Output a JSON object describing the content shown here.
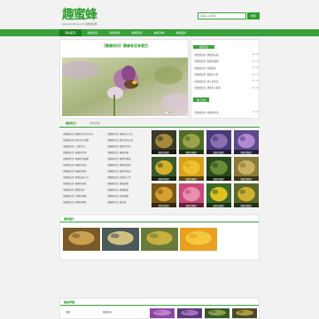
{
  "site": {
    "logo": "趣蜜蜂",
    "tagline": "www.qumifeng.com 蜜蜂知识网"
  },
  "search": {
    "placeholder": "请输入关键词",
    "button": "搜索"
  },
  "nav": [
    "网站首页",
    "蜜蜂知识",
    "蜜蜂养殖",
    "蜂蜜知识",
    "蜂蜜功效",
    "蜂蜜图片"
  ],
  "featured": {
    "title": "【蜜蜂知识】蜜蜂有没有尾巴"
  },
  "side": {
    "pill": "蜜蜂知识",
    "list1": [
      {
        "text": "【蜜蜂知识】蜂蜜的功效",
        "date": "08-20"
      },
      {
        "text": "【蜜蜂知识】蜜蜂的品种",
        "date": "08-20"
      },
      {
        "text": "【蜜蜂知识】养蜂技术",
        "date": "08-20"
      },
      {
        "text": "【蜜蜂知识】蜜蜂怎么养",
        "date": "08-20"
      },
      {
        "text": "【蜜蜂知识】蜂王的寿命",
        "date": "08-20"
      },
      {
        "text": "【蜜蜂知识】蜂蜜怎么保存",
        "date": "08-20"
      }
    ],
    "bar": "热门文章",
    "list2": [
      {
        "text": "【蜜蜂知识】蜂蜜的吃法",
        "date": "08-20"
      }
    ]
  },
  "tabs": {
    "active": "蜜蜂知识",
    "other": "蜜蜂养殖"
  },
  "articles": {
    "col1": [
      "【蜜蜂知识】蜜蜂的寿命有多长",
      "【蜜蜂知识】蜂王的产卵量",
      "【蜜蜂知识】工蜂的分工",
      "【蜜蜂知识】雄蜂的作用",
      "【蜜蜂知识】蜜蜂如何酿蜜",
      "【蜜蜂知识】蜜蜂的天敌",
      "【蜜蜂知识】蜂巢的结构",
      "【蜜蜂知识】蜜蜂会蜇人吗",
      "【蜜蜂知识】蜜蜂的视觉",
      "【蜜蜂知识】蜜蜂分蜂",
      "【蜜蜂知识】中蜂和意蜂",
      "【蜜蜂知识】蜂蜜的种类"
    ],
    "col2": [
      "【蜜蜂知识】蜜蜂怎么过冬",
      "【蜜蜂知识】蜂王浆的功效",
      "【蜜蜂知识】蜂胶的作用",
      "【蜜蜂知识】蜜蜂采蜜",
      "【蜜蜂知识】蜜蜂的舞蹈",
      "【蜜蜂知识】蜜蜂的身体",
      "【蜜蜂知识】蜂群的组成",
      "【蜜蜂知识】养蜂的工具",
      "【蜜蜂知识】蜜源植物",
      "【蜜蜂知识】蜂蜜结晶",
      "【蜜蜂知识】真假蜂蜜",
      "【蜜蜂知识】蜂花粉"
    ]
  },
  "grid": [
    {
      "caption": "蜜蜂采蜜图片",
      "color1": "#3b3a28",
      "color2": "#a58a3a"
    },
    {
      "caption": "蜜蜂采蜜图片",
      "color1": "#4f6b2a",
      "color2": "#9aa24a"
    },
    {
      "caption": "蜜蜂采蜜图片",
      "color1": "#4a3a7a",
      "color2": "#8a6fb0"
    },
    {
      "caption": "蜜蜂采蜜图片",
      "color1": "#5a4a8a",
      "color2": "#b08ad0"
    },
    {
      "caption": "蜜蜂采蜜图片",
      "color1": "#3a5a2a",
      "color2": "#d6b02a"
    },
    {
      "caption": "蜜蜂采蜜图片",
      "color1": "#d6a01a",
      "color2": "#f0c030"
    },
    {
      "caption": "蜜蜂采蜜图片",
      "color1": "#2a4a1a",
      "color2": "#6a8a3a"
    },
    {
      "caption": "蜜蜂采蜜图片",
      "color1": "#8a7a3a",
      "color2": "#c8b060"
    },
    {
      "caption": "蜜蜂采蜜图片",
      "color1": "#7a5a1a",
      "color2": "#d8a030"
    },
    {
      "caption": "蜜蜂采蜜图片",
      "color1": "#c84a7a",
      "color2": "#e890b0"
    },
    {
      "caption": "蜜蜂采蜜图片",
      "color1": "#3a6a2a",
      "color2": "#e0c020"
    },
    {
      "caption": "蜜蜂采蜜图片",
      "color1": "#5a6a2a",
      "color2": "#d0b030"
    }
  ],
  "sec2": {
    "title": "蜜蜂图片",
    "imgs": [
      {
        "color1": "#7a5a2a",
        "color2": "#c8a050"
      },
      {
        "color1": "#4a5a5a",
        "color2": "#d0c080"
      },
      {
        "color1": "#6a7a3a",
        "color2": "#c8b040"
      },
      {
        "color1": "#e8a020",
        "color2": "#f6c840"
      }
    ]
  },
  "sec3": {
    "title": "蜜蜂养殖",
    "row1": "蜜蜂",
    "row2": "蜜蜂养殖",
    "imgs": [
      {
        "color1": "#8a4aa0",
        "color2": "#c080d0"
      },
      {
        "color1": "#5a3a7a",
        "color2": "#a070c0"
      },
      {
        "color1": "#3a5a2a",
        "color2": "#8aa050"
      },
      {
        "color1": "#4a4a2a",
        "color2": "#b09a40"
      }
    ]
  },
  "colors": {
    "brand": "#2f9e2f",
    "nav": "#3aa13a",
    "nav_active": "#1f7f1f"
  }
}
